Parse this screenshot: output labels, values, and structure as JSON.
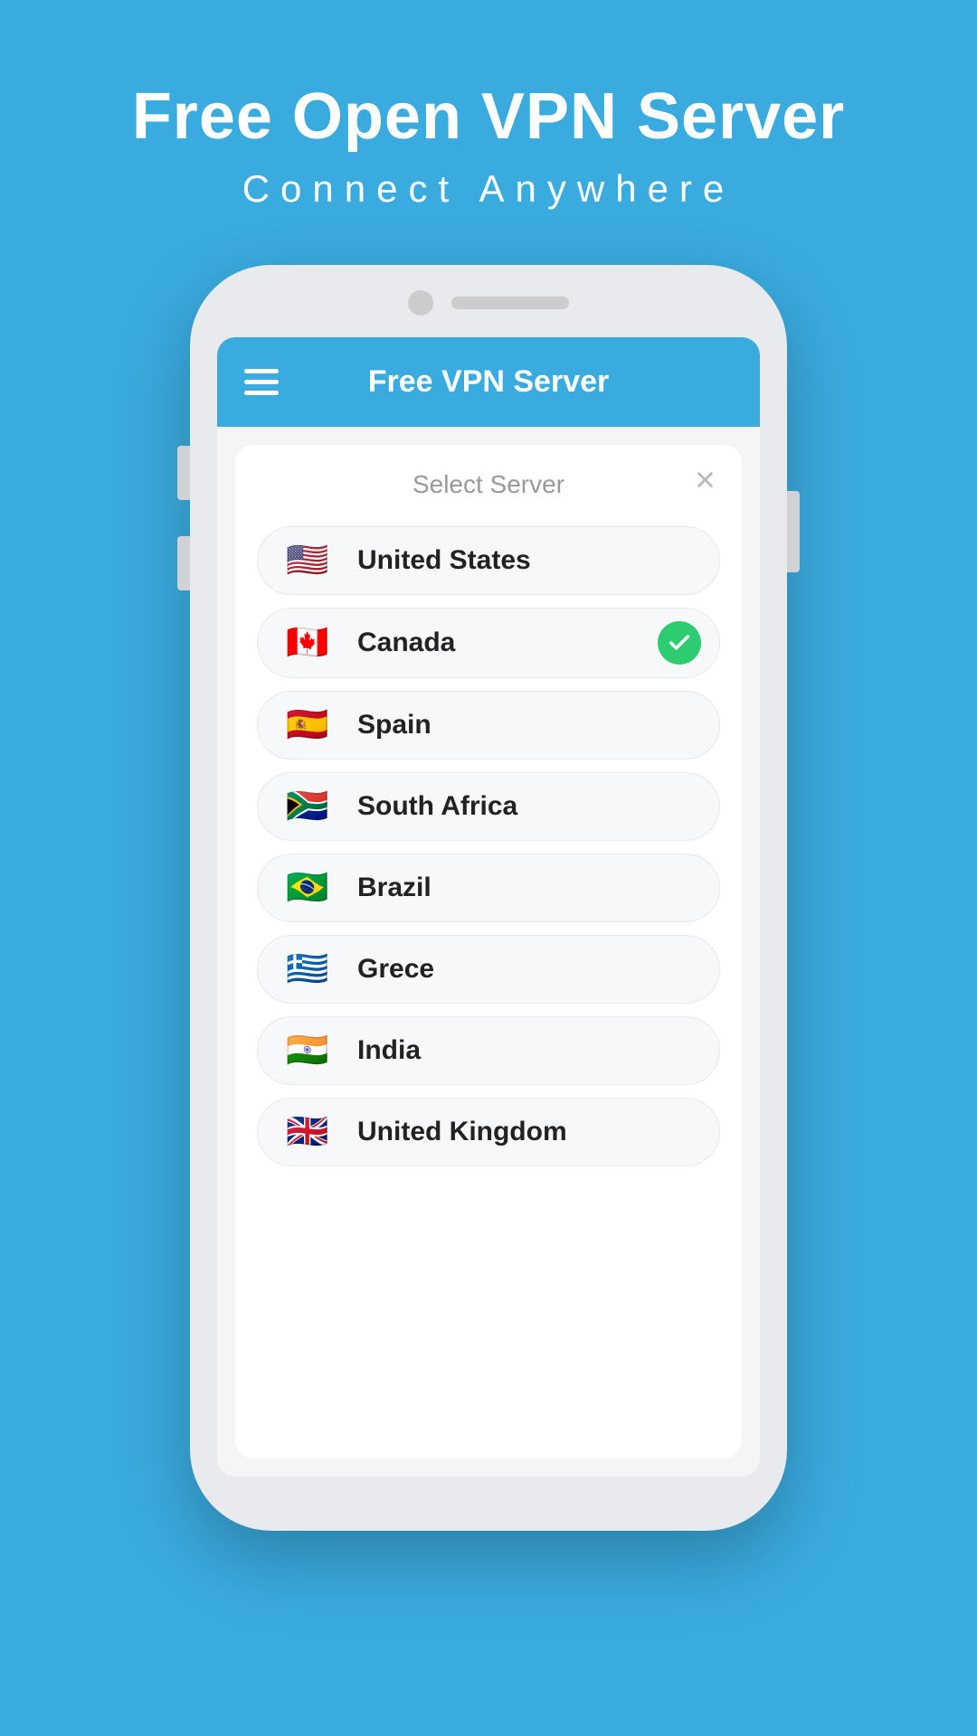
{
  "header": {
    "title": "Free Open VPN Server",
    "subtitle": "Connect Anywhere"
  },
  "app": {
    "bar_title": "Free VPN Server",
    "menu_icon": "hamburger-icon"
  },
  "dialog": {
    "title": "Select Server",
    "close_label": "✕"
  },
  "servers": [
    {
      "id": "us",
      "name": "United States",
      "flag": "🇺🇸",
      "selected": false
    },
    {
      "id": "ca",
      "name": "Canada",
      "flag": "🇨🇦",
      "selected": true
    },
    {
      "id": "es",
      "name": "Spain",
      "flag": "🇪🇸",
      "selected": false
    },
    {
      "id": "za",
      "name": "South Africa",
      "flag": "🇿🇦",
      "selected": false
    },
    {
      "id": "br",
      "name": "Brazil",
      "flag": "🇧🇷",
      "selected": false
    },
    {
      "id": "gr",
      "name": "Grece",
      "flag": "🇬🇷",
      "selected": false
    },
    {
      "id": "in",
      "name": "India",
      "flag": "🇮🇳",
      "selected": false
    },
    {
      "id": "gb",
      "name": "United Kingdom",
      "flag": "🇬🇧",
      "selected": false
    }
  ]
}
